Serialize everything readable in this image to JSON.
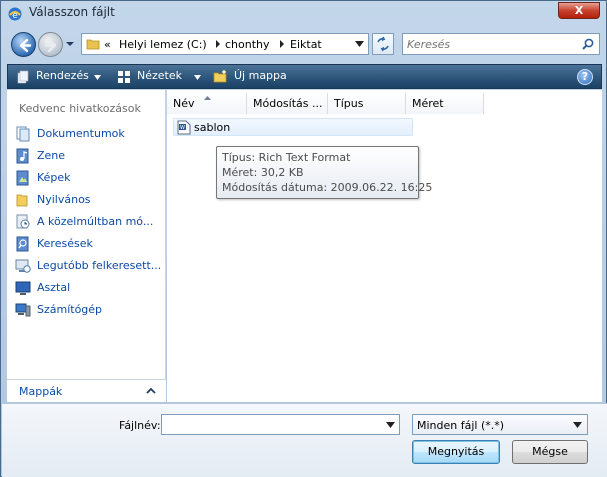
{
  "window": {
    "title": "Válasszon fájlt",
    "close_label": "X"
  },
  "address": {
    "crumbs": [
      "«",
      "Helyi lemez (C:)",
      "chonthy",
      "Eiktat"
    ],
    "search_placeholder": "Keresés"
  },
  "toolbar": {
    "organize": "Rendezés",
    "views": "Nézetek",
    "new_folder": "Új mappa",
    "help": "?"
  },
  "left_pane": {
    "header": "Kedvenc hivatkozások",
    "favorites": [
      {
        "label": "Dokumentumok",
        "icon": "documents-icon"
      },
      {
        "label": "Zene",
        "icon": "music-icon"
      },
      {
        "label": "Képek",
        "icon": "pictures-icon"
      },
      {
        "label": "Nyilvános",
        "icon": "public-folder-icon"
      },
      {
        "label": "A közelmúltban mó...",
        "icon": "recently-changed-icon"
      },
      {
        "label": "Keresések",
        "icon": "searches-icon"
      },
      {
        "label": "Legutóbb felkeresett...",
        "icon": "recent-places-icon"
      },
      {
        "label": "Asztal",
        "icon": "desktop-icon"
      },
      {
        "label": "Számítógép",
        "icon": "computer-icon"
      }
    ],
    "folders_label": "Mappák"
  },
  "file_list": {
    "columns": [
      "Név",
      "Módosítás ...",
      "Típus",
      "Méret"
    ],
    "files": [
      {
        "name": "sablon",
        "icon": "word-document-icon"
      }
    ]
  },
  "tooltip": {
    "type": "Típus: Rich Text Format",
    "size": "Méret: 30,2 KB",
    "modified": "Módosítás dátuma: 2009.06.22. 16:25"
  },
  "bottom": {
    "filename_label": "Fájlnév:",
    "filename_value": "",
    "filter_value": "Minden fájl (*.*)",
    "open_button": "Megnyitás",
    "cancel_button": "Mégse"
  }
}
